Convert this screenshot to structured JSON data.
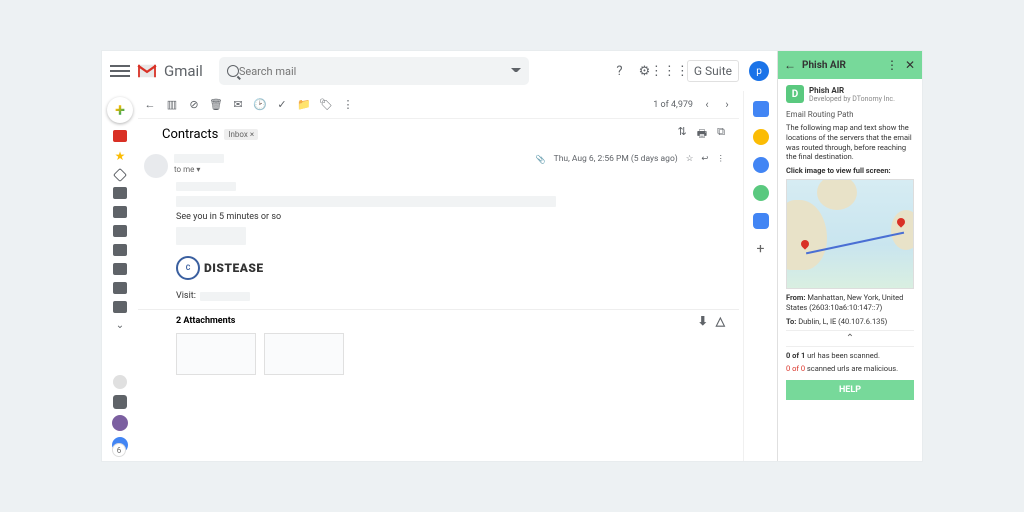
{
  "header": {
    "brand": "Gmail",
    "search_placeholder": "Search mail",
    "gsuite": "G Suite",
    "avatar_letter": "p"
  },
  "toolbar": {
    "count": "1 of 4,979"
  },
  "message": {
    "subject": "Contracts",
    "label": "Inbox ×",
    "to_line": "to me ▾",
    "date": "Thu, Aug 6, 2:56 PM (5 days ago)",
    "body_line": "See you in 5 minutes or so",
    "logo_text": "DISTEASE",
    "visit": "Visit:",
    "attachments_title": "2 Attachments"
  },
  "addon": {
    "title": "Phish AIR",
    "app_name": "Phish AIR",
    "developer": "Developed by DTonomy Inc.",
    "section": "Email Routing Path",
    "desc": "The following map and text show the locations of the servers that the email was routed through, before reaching the final destination.",
    "prompt": "Click image to view full screen:",
    "from_label": "From:",
    "from_val": "Manhattan, New York, United States (2603:10a6:10:147::7)",
    "to_label": "To:",
    "to_val": "Dublin, L, IE (40.107.6.135)",
    "scan1a": "0 of 1",
    "scan1b": " url has been scanned.",
    "scan2a": "0 of 0",
    "scan2b": " scanned urls are malicious.",
    "help": "HELP"
  },
  "badge": "6"
}
